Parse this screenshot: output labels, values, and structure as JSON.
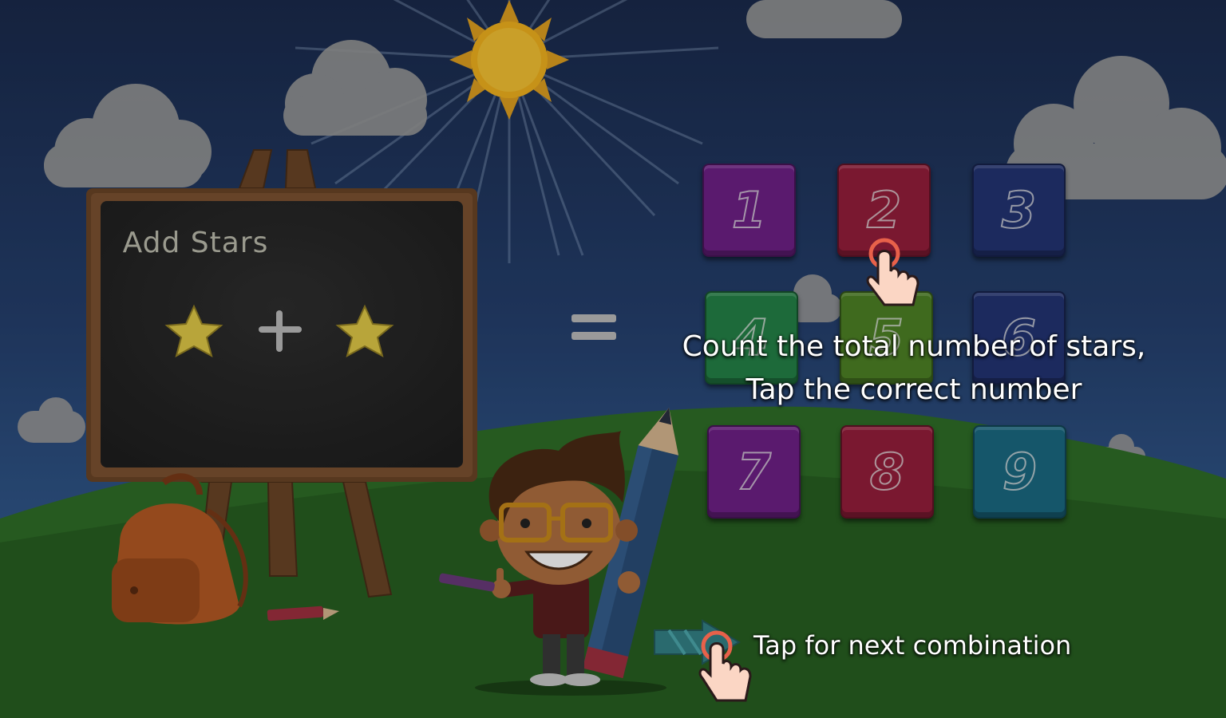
{
  "game": {
    "board_title": "Add Stars",
    "instruction_line1": "Count the total number of stars,",
    "instruction_line2": "Tap the correct number",
    "next_hint": "Tap for next combination",
    "equation": {
      "left_stars": 1,
      "operator": "+",
      "right_stars": 1,
      "equals": "="
    },
    "number_buttons": [
      {
        "label": "1",
        "color": "#5a1a6e"
      },
      {
        "label": "2",
        "color": "#7a1830"
      },
      {
        "label": "3",
        "color": "#1c2a5e"
      },
      {
        "label": "4",
        "color": "#1d6a3a"
      },
      {
        "label": "5",
        "color": "#3f6a1e"
      },
      {
        "label": "6",
        "color": "#1c2a5e"
      },
      {
        "label": "7",
        "color": "#5a1a6e"
      },
      {
        "label": "8",
        "color": "#7a1830"
      },
      {
        "label": "9",
        "color": "#15566a"
      }
    ]
  },
  "colors": {
    "sky": "#25406e",
    "grass": "#2e6a26",
    "chalkboard": "#262626",
    "wood": "#6b4526",
    "sun": "#f2b21e"
  }
}
